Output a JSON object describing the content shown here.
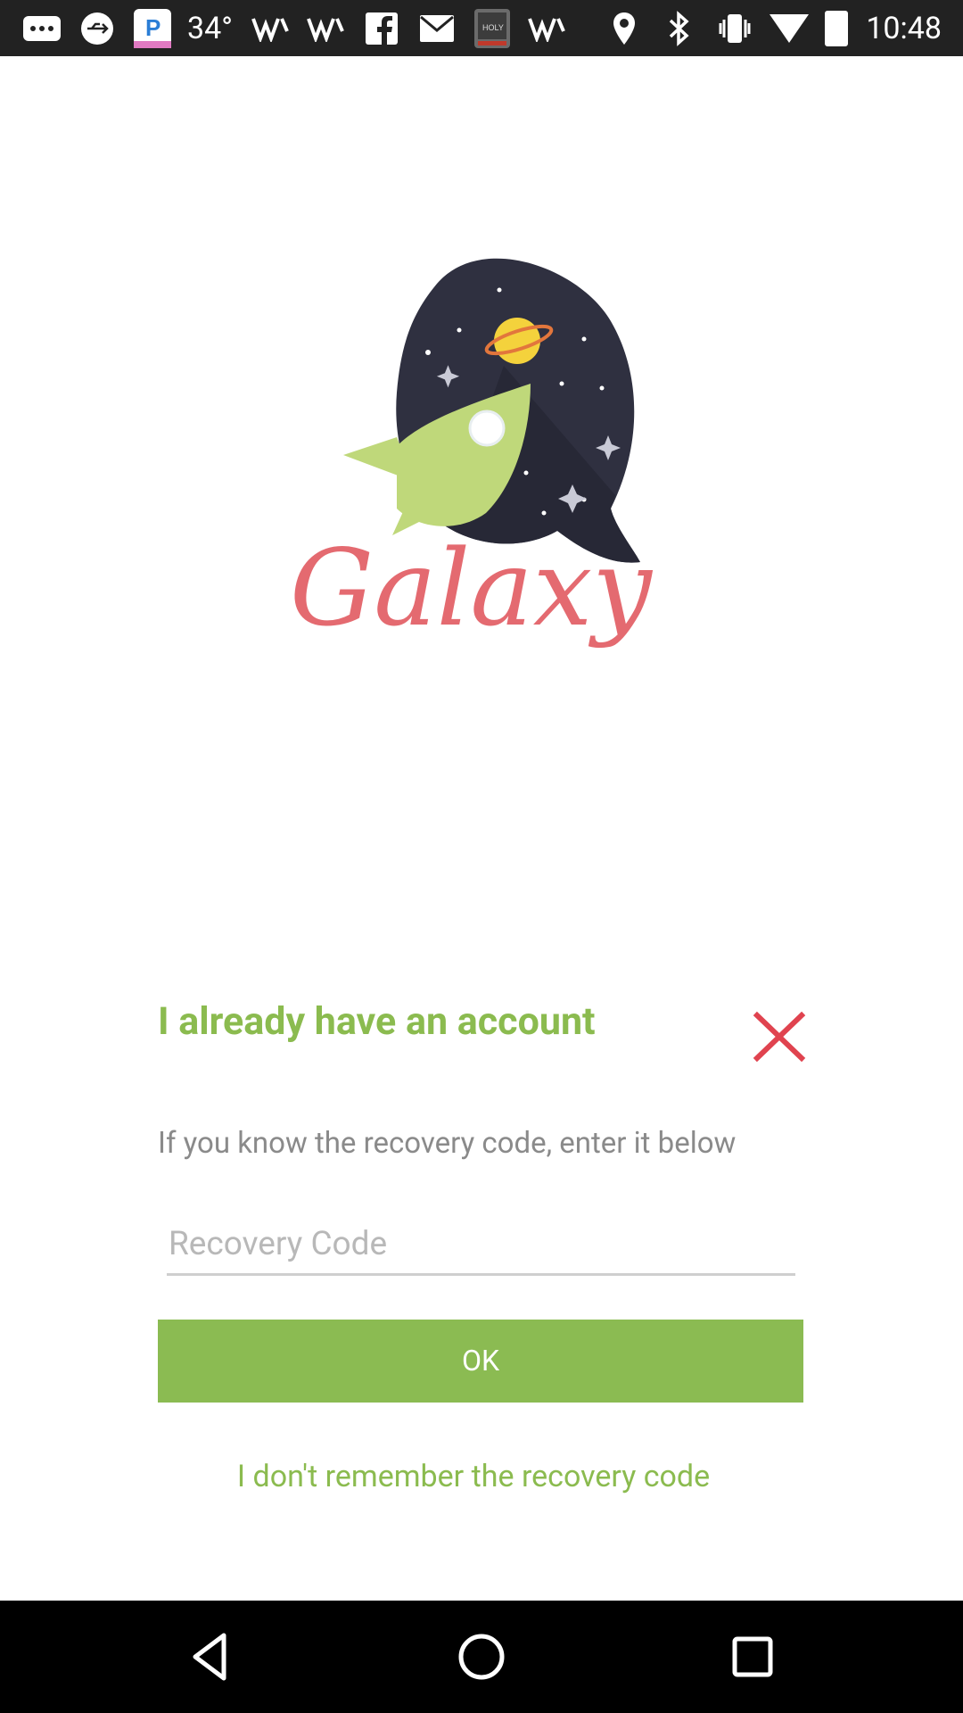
{
  "status_bar": {
    "temperature": "34°",
    "time": "10:48",
    "icons": [
      "more-icon",
      "usb-icon",
      "pandora-icon",
      "temperature",
      "signal-w-icon",
      "signal-w-icon",
      "facebook-icon",
      "gmail-icon",
      "bible-icon",
      "signal-w-icon",
      "location-icon",
      "bluetooth-icon",
      "vibrate-icon",
      "wifi-icon",
      "battery-icon"
    ]
  },
  "logo": {
    "text": "Galaxy",
    "colors": {
      "bubble": "#2f3040",
      "rocket": "#bfd87a",
      "planet": "#f4d23c",
      "text": "#e46a70"
    }
  },
  "dialog": {
    "title": "I already have an account",
    "subtitle": "If you know the recovery code, enter it below",
    "input_placeholder": "Recovery Code",
    "input_value": "",
    "ok_label": "OK",
    "forgot_label": "I don't remember the recovery code",
    "close_icon": "close-icon"
  },
  "colors": {
    "accent": "#8bbb52",
    "close": "#e0434f",
    "muted_text": "#8a8a8a"
  },
  "nav_bar": {
    "buttons": [
      "back-icon",
      "home-icon",
      "recents-icon"
    ]
  }
}
